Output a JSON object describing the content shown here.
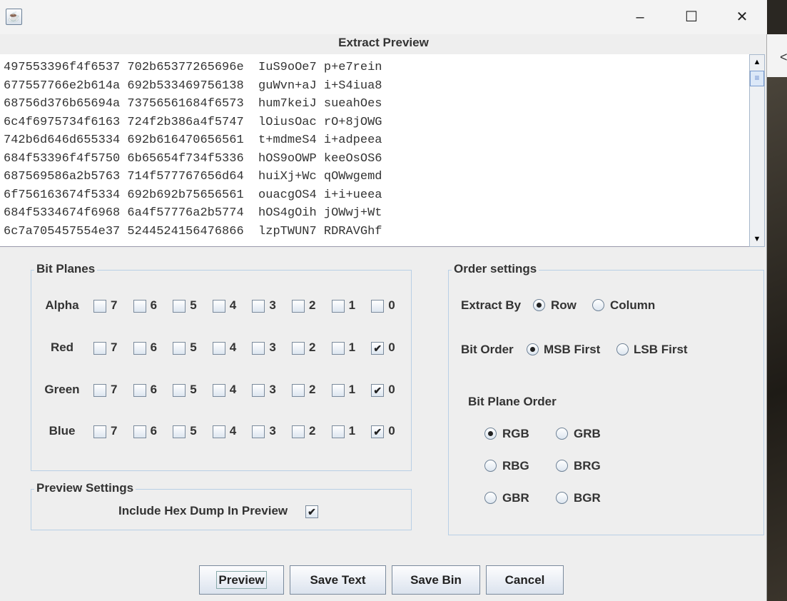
{
  "window": {
    "icon": "java-icon",
    "controls": [
      "minimize",
      "maximize",
      "close"
    ]
  },
  "preview": {
    "title": "Extract Preview",
    "lines": [
      "497553396f4f6537 702b65377265696e  IuS9oOe7 p+e7rein",
      "677557766e2b614a 692b533469756138  guWvn+aJ i+S4iua8",
      "68756d376b65694a 73756561684f6573  hum7keiJ sueahOes",
      "6c4f6975734f6163 724f2b386a4f5747  lOiusOac rO+8jOWG",
      "742b6d646d655334 692b616470656561  t+mdmeS4 i+adpeea",
      "684f53396f4f5750 6b65654f734f5336  hOS9oOWP keeOsOS6",
      "687569586a2b5763 714f577767656d64  huiXj+Wc qOWwgemd",
      "6f756163674f5334 692b692b75656561  ouacgOS4 i+i+ueea",
      "684f5334674f6968 6a4f57776a2b5774  hOS4gOih jOWwj+Wt",
      "6c7a705457554e37 5244524156476866  lzpTWUN7 RDRAVGhf"
    ]
  },
  "bit_planes": {
    "title": "Bit Planes",
    "bits": [
      "7",
      "6",
      "5",
      "4",
      "3",
      "2",
      "1",
      "0"
    ],
    "channels": [
      {
        "name": "Alpha",
        "checked": [
          false,
          false,
          false,
          false,
          false,
          false,
          false,
          false
        ]
      },
      {
        "name": "Red",
        "checked": [
          false,
          false,
          false,
          false,
          false,
          false,
          false,
          true
        ]
      },
      {
        "name": "Green",
        "checked": [
          false,
          false,
          false,
          false,
          false,
          false,
          false,
          true
        ]
      },
      {
        "name": "Blue",
        "checked": [
          false,
          false,
          false,
          false,
          false,
          false,
          false,
          true
        ]
      }
    ]
  },
  "preview_settings": {
    "title": "Preview Settings",
    "hex_dump_label": "Include Hex Dump In Preview",
    "hex_dump_checked": true
  },
  "order": {
    "title": "Order settings",
    "extract_by_label": "Extract By",
    "row": "Row",
    "column": "Column",
    "extract_by": "Row",
    "bit_order_label": "Bit Order",
    "msb": "MSB First",
    "lsb": "LSB First",
    "bit_order": "MSB First",
    "plane_order_label": "Bit Plane Order",
    "plane_options": [
      "RGB",
      "GRB",
      "RBG",
      "BRG",
      "GBR",
      "BGR"
    ],
    "plane_order": "RGB"
  },
  "buttons": {
    "preview": "Preview",
    "save_text": "Save Text",
    "save_bin": "Save Bin",
    "cancel": "Cancel"
  }
}
